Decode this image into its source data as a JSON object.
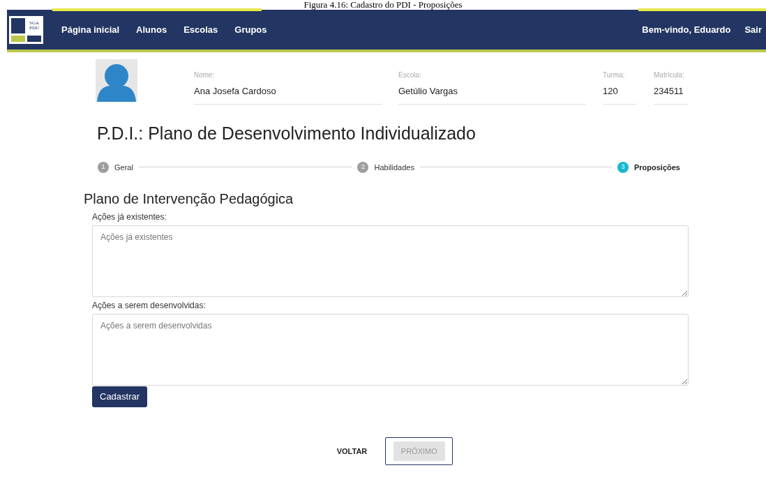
{
  "caption": "Figura 4.16: Cadastro do PDI - Proposições",
  "nav": {
    "logo": [
      "SGA",
      "PDU"
    ],
    "items": [
      "Página inicial",
      "Alunos",
      "Escolas",
      "Grupos"
    ],
    "welcome": "Bem-vindo, Eduardo",
    "logout": "Sair"
  },
  "student": {
    "fields": [
      {
        "label": "Nome:",
        "value": "Ana Josefa Cardoso",
        "kind": "wide"
      },
      {
        "label": "Escola:",
        "value": "Getúlio Vargas",
        "kind": "wide"
      },
      {
        "label": "Turma:",
        "value": "120",
        "kind": "narrow"
      },
      {
        "label": "Matrícula:",
        "value": "234511",
        "kind": "narrow"
      }
    ]
  },
  "title": "P.D.I.: Plano de Desenvolvimento Individualizado",
  "steps": [
    {
      "number": "1",
      "label": "Geral",
      "selected": false
    },
    {
      "number": "2",
      "label": "Habilidades",
      "selected": false
    },
    {
      "number": "3",
      "label": "Proposições",
      "selected": true
    }
  ],
  "section": "Plano de Intervenção Pedagógica",
  "textareas": [
    {
      "label": "Ações já existentes:",
      "placeholder": "Ações já existentes"
    },
    {
      "label": "Ações a serem desenvolvidas:",
      "placeholder": "Ações a serem desenvolvidas"
    }
  ],
  "submit": "Cadastrar",
  "back": "VOLTAR",
  "next": {
    "label": "PRÓXIMO",
    "disabled": true
  }
}
